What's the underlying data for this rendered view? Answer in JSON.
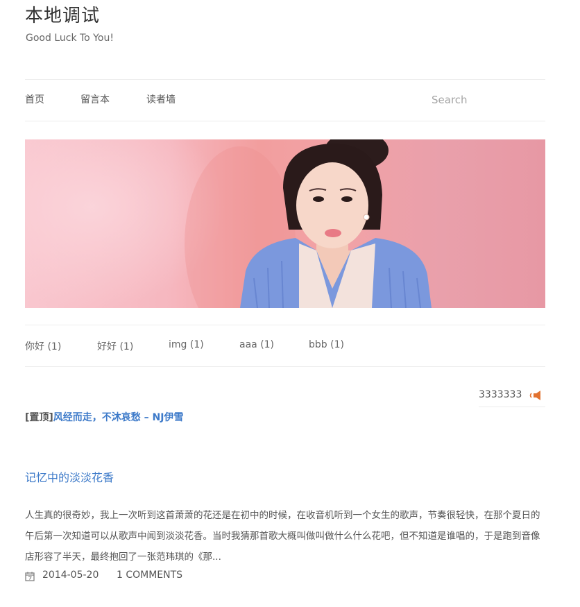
{
  "site": {
    "title": "本地调试",
    "description": "Good Luck To You!"
  },
  "nav": {
    "items": [
      "首页",
      "留言本",
      "读者墙"
    ],
    "search_placeholder": "Search"
  },
  "banner": {
    "image": "portrait-banner"
  },
  "tags": [
    {
      "label": "你好 (1)"
    },
    {
      "label": "好好 (1)"
    },
    {
      "label": "img (1)"
    },
    {
      "label": "aaa (1)"
    },
    {
      "label": "bbb (1)"
    }
  ],
  "notice": {
    "text": "3333333",
    "icon": "speaker-icon"
  },
  "sticky_post": {
    "tag": "[置顶]",
    "title": "风经而走，不沐哀愁 – NJ伊雪"
  },
  "post": {
    "title": "记忆中的淡淡花香",
    "excerpt": "人生真的很奇妙，我上一次听到这首萧萧的花还是在初中的时候，在收音机听到一个女生的歌声，节奏很轻快，在那个夏日的午后第一次知道可以从歌声中闻到淡淡花香。当时我猜那首歌大概叫做叫做什么什么花吧，但不知道是谁唱的，于是跑到音像店形容了半天，最终抱回了一张范玮琪的《那...",
    "date": "2014-05-20",
    "comments": "1 COMMENTS",
    "calendar_icon": "calendar-icon"
  },
  "colors": {
    "link": "#3d7ac9",
    "text": "#555555",
    "divider": "#ececec",
    "speaker": "#e2722f"
  }
}
